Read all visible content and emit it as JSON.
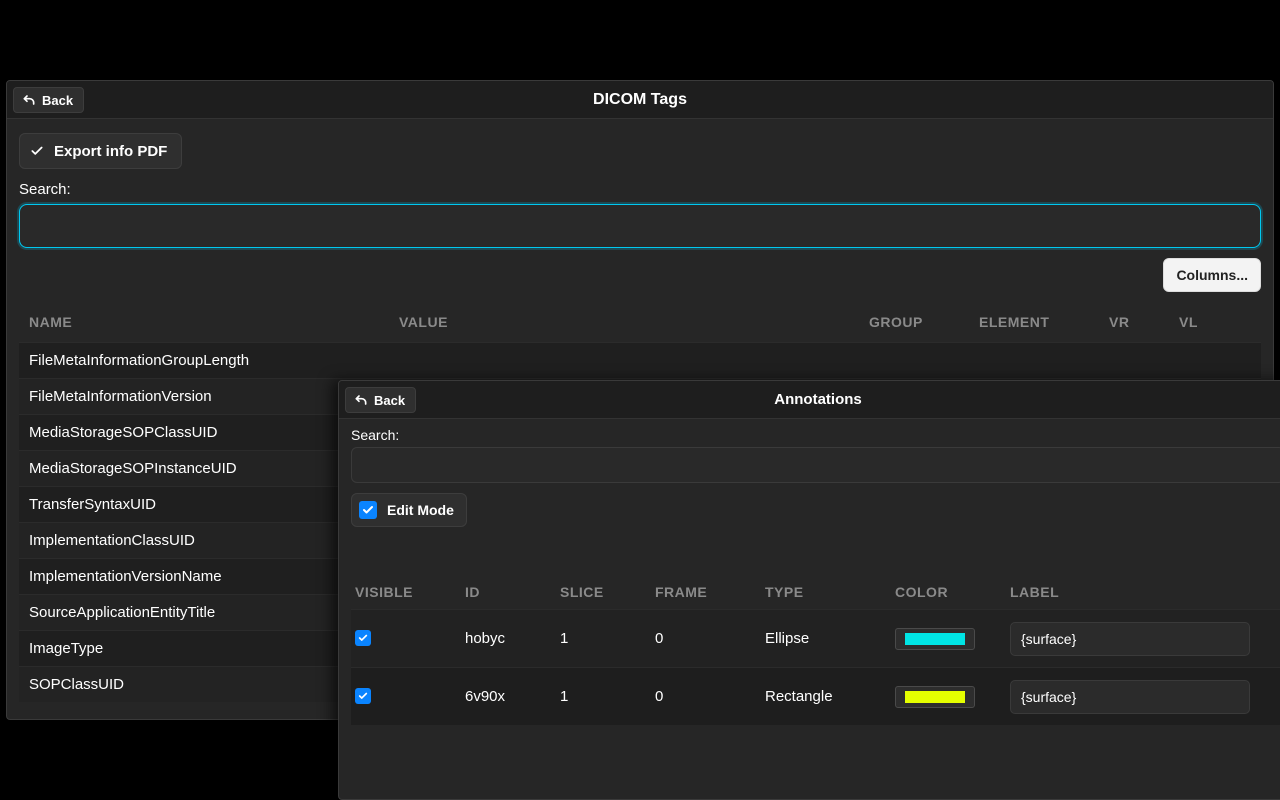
{
  "dicom": {
    "title": "DICOM Tags",
    "back_label": "Back",
    "export_label": "Export info PDF",
    "search_label": "Search:",
    "search_value": "",
    "columns_label": "Columns...",
    "columns": [
      "NAME",
      "VALUE",
      "GROUP",
      "ELEMENT",
      "VR",
      "VL"
    ],
    "rows": [
      {
        "name": "FileMetaInformationGroupLength"
      },
      {
        "name": "FileMetaInformationVersion"
      },
      {
        "name": "MediaStorageSOPClassUID"
      },
      {
        "name": "MediaStorageSOPInstanceUID"
      },
      {
        "name": "TransferSyntaxUID"
      },
      {
        "name": "ImplementationClassUID"
      },
      {
        "name": "ImplementationVersionName"
      },
      {
        "name": "SourceApplicationEntityTitle"
      },
      {
        "name": "ImageType"
      },
      {
        "name": "SOPClassUID"
      }
    ]
  },
  "ann": {
    "title": "Annotations",
    "back_label": "Back",
    "search_label": "Search:",
    "search_value": "",
    "editmode_label": "Edit Mode",
    "editmode_checked": true,
    "columns": [
      "VISIBLE",
      "ID",
      "SLICE",
      "FRAME",
      "TYPE",
      "COLOR",
      "LABEL"
    ],
    "rows": [
      {
        "visible": true,
        "id": "hobyc",
        "slice": "1",
        "frame": "0",
        "type": "Ellipse",
        "color": "#00e5e5",
        "label": "{surface}"
      },
      {
        "visible": true,
        "id": "6v90x",
        "slice": "1",
        "frame": "0",
        "type": "Rectangle",
        "color": "#e5ff00",
        "label": "{surface}"
      }
    ]
  }
}
